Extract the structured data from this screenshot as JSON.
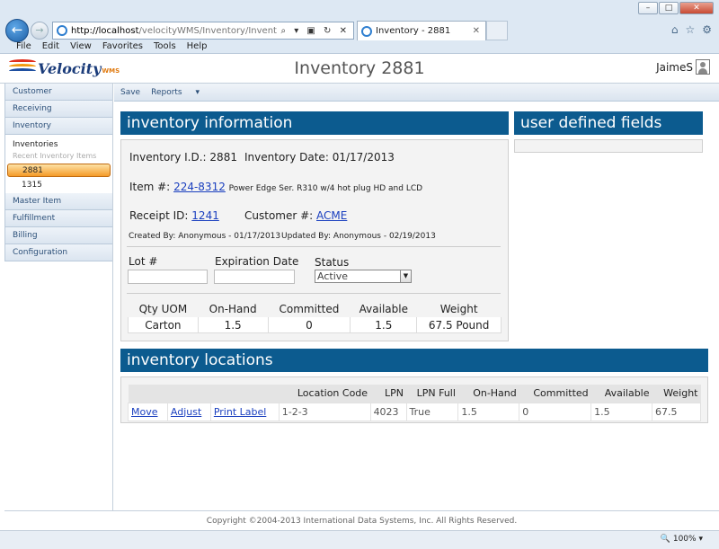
{
  "browser": {
    "url_host": "http://localhost",
    "url_path": "/velocityWMS/Inventory/Inventory.aspx?INVENTORY_",
    "tab_title": "Inventory - 2881",
    "addr_controls": "⌕ ▾ ▣ ↻ ✕",
    "tab_close": "✕",
    "menu": [
      "File",
      "Edit",
      "View",
      "Favorites",
      "Tools",
      "Help"
    ],
    "zoom": "100%",
    "window_buttons": [
      "–",
      "□",
      "✕"
    ]
  },
  "app": {
    "brand": "Velocity",
    "brand_suffix": "WMS",
    "page_title": "Inventory 2881",
    "user": "JaimeS"
  },
  "sidebar": {
    "items_top": [
      "Customer",
      "Receiving",
      "Inventory"
    ],
    "sub_heading": "Inventories",
    "recent_label": "Recent Inventory Items",
    "selected": "2881",
    "recent": [
      "1315"
    ],
    "items_bottom": [
      "Master Item",
      "Fulfillment",
      "Billing",
      "Configuration"
    ]
  },
  "toolbar": {
    "save": "Save",
    "reports": "Reports",
    "reports_caret": "▾"
  },
  "info": {
    "header": "inventory information",
    "inv_id_label": "Inventory I.D.:",
    "inv_id": "2881",
    "inv_date_label": "Inventory Date:",
    "inv_date": "01/17/2013",
    "item_label": "Item #:",
    "item_number": "224-8312",
    "item_desc": "Power Edge Ser. R310 w/4 hot plug HD and LCD",
    "receipt_label": "Receipt ID:",
    "receipt_id": "1241",
    "customer_label": "Customer #:",
    "customer": "ACME",
    "created": "Created By: Anonymous - 01/17/2013",
    "updated": "Updated By: Anonymous - 02/19/2013",
    "lot_label": "Lot #",
    "exp_label": "Expiration Date",
    "status_label": "Status",
    "status_value": "Active",
    "qty_headers": [
      "Qty UOM",
      "On-Hand",
      "Committed",
      "Available",
      "Weight"
    ],
    "qty_values": [
      "Carton",
      "1.5",
      "0",
      "1.5",
      "67.5 Pound"
    ]
  },
  "udf": {
    "header": "user defined fields"
  },
  "locations": {
    "header": "inventory locations",
    "columns": [
      "",
      "",
      "",
      "Location Code",
      "LPN",
      "LPN Full",
      "On-Hand",
      "Committed",
      "Available",
      "Weight"
    ],
    "row": {
      "move": "Move",
      "adjust": "Adjust",
      "print": "Print Label",
      "location_code": "1-2-3",
      "lpn": "4023",
      "lpn_full": "True",
      "on_hand": "1.5",
      "committed": "0",
      "available": "1.5",
      "weight": "67.5"
    }
  },
  "footer": {
    "copyright": "Copyright ©2004-2013 International Data Systems, Inc. All Rights Reserved."
  }
}
